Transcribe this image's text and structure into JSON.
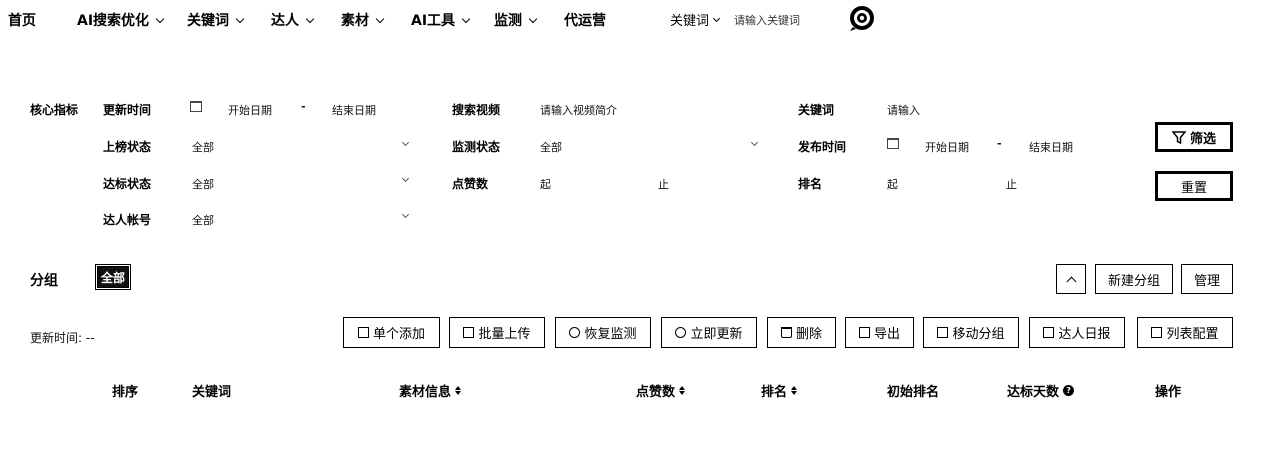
{
  "nav": {
    "items": [
      {
        "label": "首页",
        "dropdown": false
      },
      {
        "label": "AI搜索优化",
        "dropdown": true
      },
      {
        "label": "关键词",
        "dropdown": true
      },
      {
        "label": "达人",
        "dropdown": true
      },
      {
        "label": "素材",
        "dropdown": true
      },
      {
        "label": "AI工具",
        "dropdown": true
      },
      {
        "label": "监测",
        "dropdown": true
      },
      {
        "label": "代运营",
        "dropdown": false
      }
    ],
    "search_type": "关键词",
    "search_placeholder": "请输入关键词"
  },
  "filters": {
    "section_title": "核心指标",
    "update_time": {
      "label": "更新时间",
      "start": "开始日期",
      "sep": "-",
      "end": "结束日期"
    },
    "search_video": {
      "label": "搜索视频",
      "placeholder": "请输入视频简介"
    },
    "keyword": {
      "label": "关键词",
      "placeholder": "请输入"
    },
    "list_status": {
      "label": "上榜状态",
      "value": "全部"
    },
    "monitor_status": {
      "label": "监测状态",
      "value": "全部"
    },
    "publish_time": {
      "label": "发布时间",
      "start": "开始日期",
      "sep": "-",
      "end": "结束日期"
    },
    "reach_status": {
      "label": "达标状态",
      "value": "全部"
    },
    "likes": {
      "label": "点赞数",
      "from": "起",
      "to": "止"
    },
    "rank": {
      "label": "排名",
      "from": "起",
      "to": "止"
    },
    "influencer_account": {
      "label": "达人帐号",
      "value": "全部"
    },
    "filter_button": "筛选",
    "reset_button": "重置"
  },
  "groups": {
    "label": "分组",
    "active_chip": "全部",
    "new_group_button": "新建分组",
    "manage_button": "管理"
  },
  "toolbar": {
    "update_time_label": "更新时间: --",
    "buttons": [
      {
        "label": "单个添加",
        "icon": "upload-icon"
      },
      {
        "label": "批量上传",
        "icon": "upload-icon"
      },
      {
        "label": "恢复监测",
        "icon": "restore-icon"
      },
      {
        "label": "立即更新",
        "icon": "refresh-icon"
      },
      {
        "label": "删除",
        "icon": "trash-icon"
      },
      {
        "label": "导出",
        "icon": "export-icon"
      },
      {
        "label": "移动分组",
        "icon": "move-icon"
      },
      {
        "label": "达人日报",
        "icon": "calendar-icon"
      },
      {
        "label": "列表配置",
        "icon": "list-settings-icon"
      }
    ]
  },
  "table": {
    "columns": [
      "排序",
      "关键词",
      "素材信息",
      "点赞数",
      "排名",
      "初始排名",
      "达标天数",
      "操作"
    ]
  }
}
